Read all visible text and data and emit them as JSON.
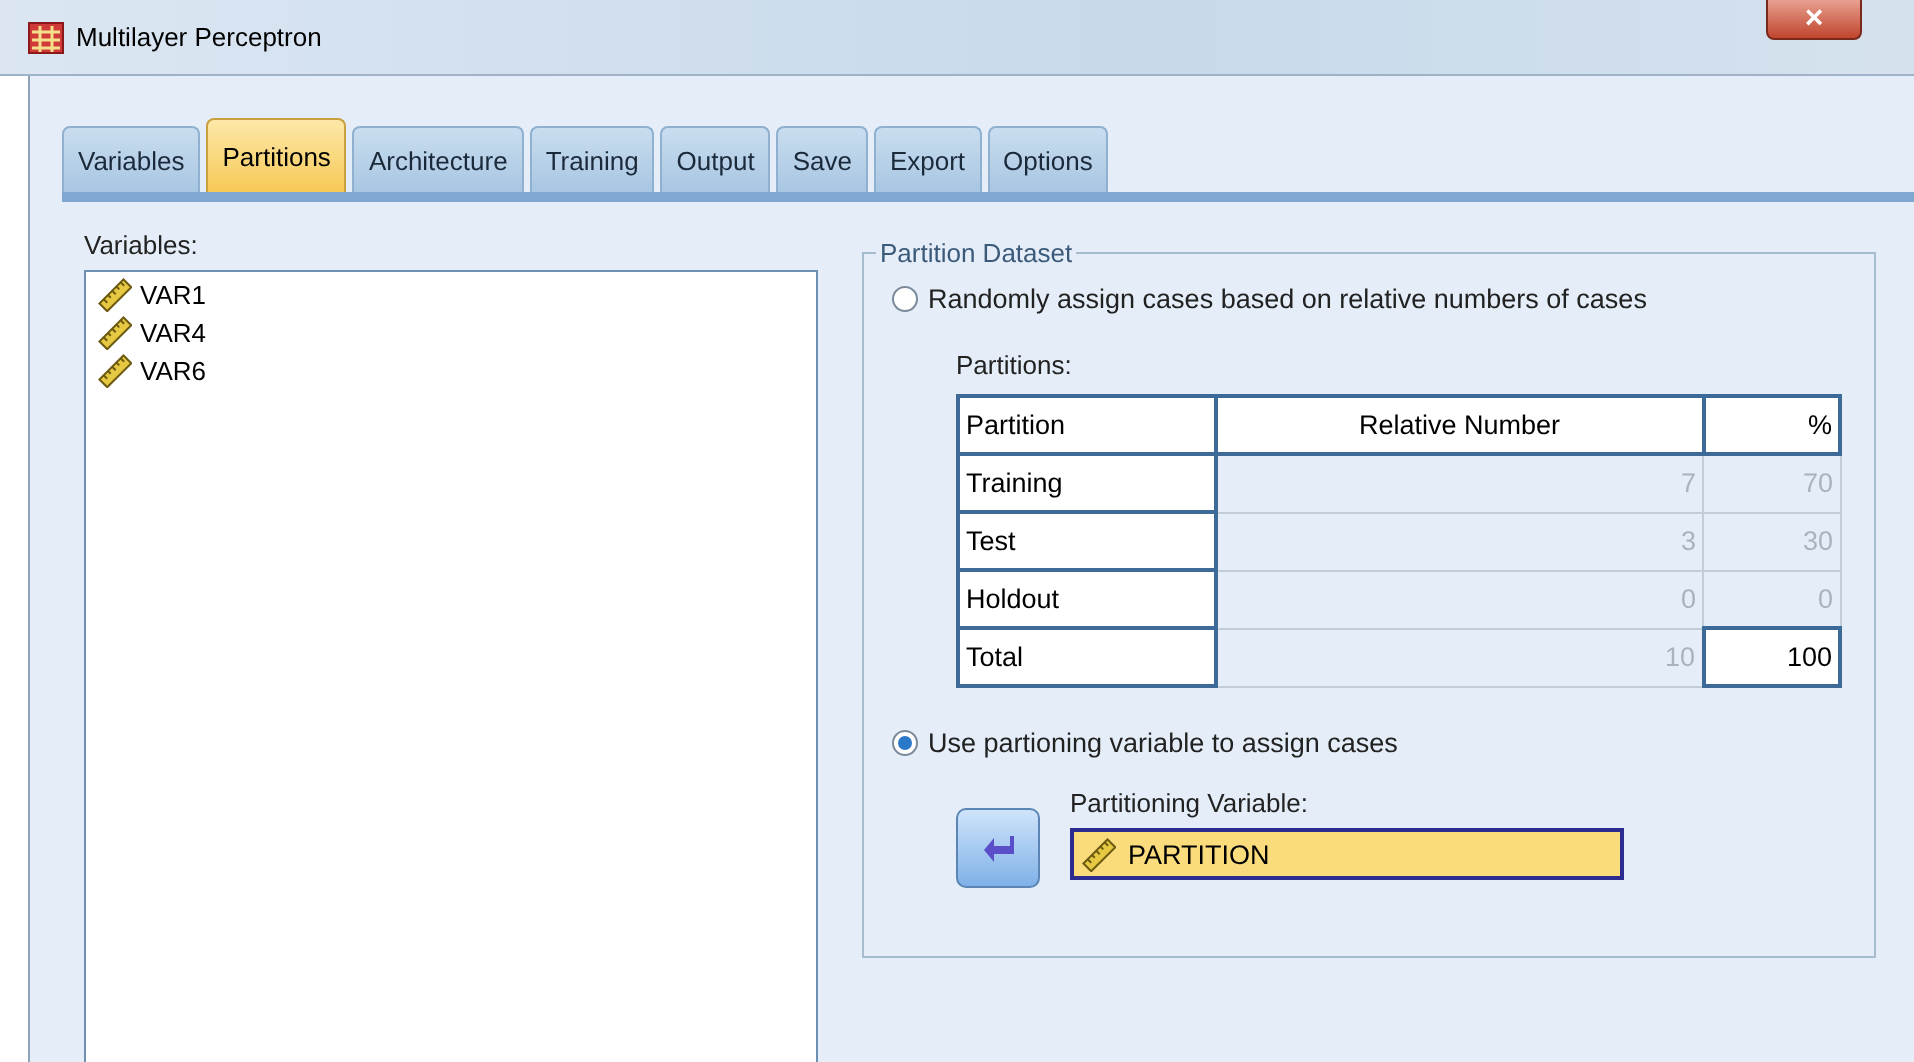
{
  "window": {
    "title": "Multilayer Perceptron",
    "close": "×"
  },
  "tabs": [
    {
      "label": "Variables",
      "selected": false
    },
    {
      "label": "Partitions",
      "selected": true
    },
    {
      "label": "Architecture",
      "selected": false
    },
    {
      "label": "Training",
      "selected": false
    },
    {
      "label": "Output",
      "selected": false
    },
    {
      "label": "Save",
      "selected": false
    },
    {
      "label": "Export",
      "selected": false
    },
    {
      "label": "Options",
      "selected": false
    }
  ],
  "variables": {
    "label": "Variables:",
    "items": [
      {
        "name": "VAR1",
        "selected": false
      },
      {
        "name": "VAR4",
        "selected": false
      },
      {
        "name": "VAR6",
        "selected": false
      }
    ]
  },
  "partition_dataset": {
    "title": "Partition Dataset",
    "options": [
      {
        "label": "Randomly assign cases based on relative numbers of cases",
        "selected": false
      },
      {
        "label": "Use partioning variable to assign cases",
        "selected": true
      }
    ],
    "partitions_label": "Partitions:",
    "table": {
      "columns": [
        "Partition",
        "Relative Number",
        "%"
      ],
      "rows": [
        {
          "partition": "Training",
          "relative": "7",
          "percent": "70",
          "relative_disabled": true,
          "percent_disabled": true
        },
        {
          "partition": "Test",
          "relative": "3",
          "percent": "30",
          "relative_disabled": true,
          "percent_disabled": true
        },
        {
          "partition": "Holdout",
          "relative": "0",
          "percent": "0",
          "relative_disabled": true,
          "percent_disabled": true
        },
        {
          "partition": "Total",
          "relative": "10",
          "percent": "100",
          "relative_disabled": true,
          "percent_disabled": false
        }
      ]
    },
    "partitioning_variable": {
      "label": "Partitioning Variable:",
      "value": "PARTITION"
    }
  }
}
